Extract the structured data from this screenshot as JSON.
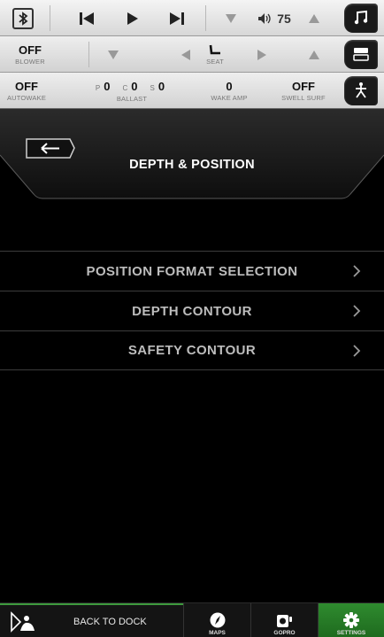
{
  "media_bar": {
    "icons": [
      "bluetooth-icon",
      "skip-previous-icon",
      "play-icon",
      "skip-next-icon",
      "volume-down-icon",
      "speaker-icon",
      "volume-up-icon",
      "music-note-icon"
    ],
    "volume": "75"
  },
  "control_bar": {
    "blower": {
      "value": "OFF",
      "label": "BLOWER"
    },
    "seat_label": "SEAT",
    "icons": [
      "chevron-down-icon",
      "chevron-left-icon",
      "seat-icon",
      "chevron-right-icon",
      "chevron-up-icon",
      "panel-toggle-icon"
    ]
  },
  "status_bar": {
    "autowake": {
      "value": "OFF",
      "label": "AUTOWAKE"
    },
    "ballast": {
      "label": "BALLAST",
      "port_label": "P",
      "port_value": "0",
      "center_label": "C",
      "center_value": "0",
      "starboard_label": "S",
      "starboard_value": "0"
    },
    "wake_amp": {
      "value": "0",
      "label": "WAKE AMP"
    },
    "swell_surf": {
      "value": "OFF",
      "label": "SWELL SURF"
    },
    "icons": [
      "wake-surfer-icon"
    ]
  },
  "header": {
    "title": "DEPTH & POSITION",
    "back_icon": "back-arrow-icon"
  },
  "menu": {
    "items": [
      {
        "label": "POSITION FORMAT SELECTION"
      },
      {
        "label": "DEPTH CONTOUR"
      },
      {
        "label": "SAFETY CONTOUR"
      }
    ],
    "chevron_icon": "chevron-right-icon"
  },
  "bottom_nav": {
    "back_to_dock": "BACK TO DOCK",
    "tabs": [
      {
        "label": "MAPS",
        "icon": "compass-icon"
      },
      {
        "label": "GOPRO",
        "icon": "camera-icon"
      },
      {
        "label": "SETTINGS",
        "icon": "gear-icon"
      }
    ],
    "active_tab": "SETTINGS",
    "accent_color": "#2f8b2f"
  }
}
